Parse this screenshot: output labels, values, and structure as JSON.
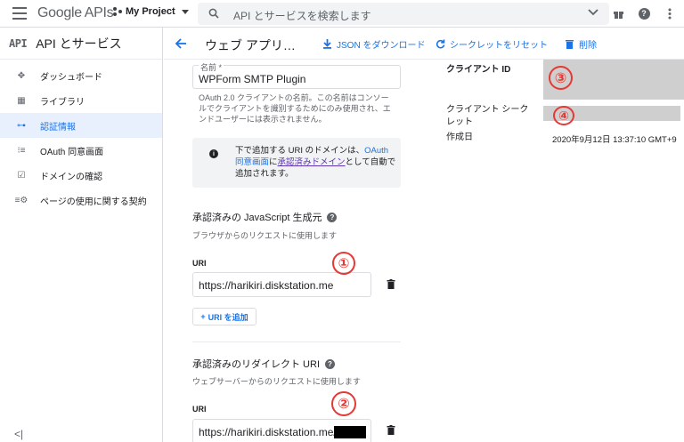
{
  "header": {
    "logo_google": "Google",
    "logo_apis": "APIs",
    "project_name": "My Project",
    "search_placeholder": "API とサービスを検索します"
  },
  "sidebar": {
    "badge": "API",
    "title": "API とサービス",
    "items": [
      {
        "label": "ダッシュボード",
        "icon": "dashboard-icon",
        "active": false
      },
      {
        "label": "ライブラリ",
        "icon": "library-icon",
        "active": false
      },
      {
        "label": "認証情報",
        "icon": "key-icon",
        "active": true
      },
      {
        "label": "OAuth 同意画面",
        "icon": "consent-icon",
        "active": false
      },
      {
        "label": "ドメインの確認",
        "icon": "domain-check-icon",
        "active": false
      },
      {
        "label": "ページの使用に関する契約",
        "icon": "agreement-icon",
        "active": false
      }
    ]
  },
  "subheader": {
    "title": "ウェブ アプリ…",
    "download_json": "JSON をダウンロード",
    "reset_secret": "シークレットをリセット",
    "delete": "削除"
  },
  "form": {
    "name_label": "名前 *",
    "name_value": "WPForm SMTP Plugin",
    "name_help": "OAuth 2.0 クライアントの名前。この名前はコンソールでクライアントを識別するためにのみ使用され、エンドユーザーには表示されません。",
    "info_pre": "下で追加する URI のドメインは、",
    "info_link1": "OAuth 同意画面",
    "info_mid": "に",
    "info_link2": "承認済みドメイン",
    "info_post": "として自動で追加されます。",
    "js_origins_title": "承認済みの JavaScript 生成元",
    "js_origins_sub": "ブラウザからのリクエストに使用します",
    "uri_label_1": "URI",
    "uri_value_1": "https://harikiri.diskstation.me",
    "add_uri": "URI を追加",
    "redirect_title": "承認済みのリダイレクト URI",
    "redirect_sub": "ウェブサーバーからのリクエストに使用します",
    "uri_label_2": "URI",
    "uri_value_2": "https://harikiri.diskstation.me/"
  },
  "details": {
    "client_id_label": "クライアント ID",
    "client_secret_label": "クライアント シークレット",
    "created_label": "作成日",
    "created_value": "2020年9月12日 13:37:10 GMT+9"
  },
  "annotations": [
    "①",
    "②",
    "③",
    "④"
  ],
  "colors": {
    "accent": "#1a73e8",
    "active_bg": "#e8f0fe",
    "annotation": "#e53935"
  }
}
